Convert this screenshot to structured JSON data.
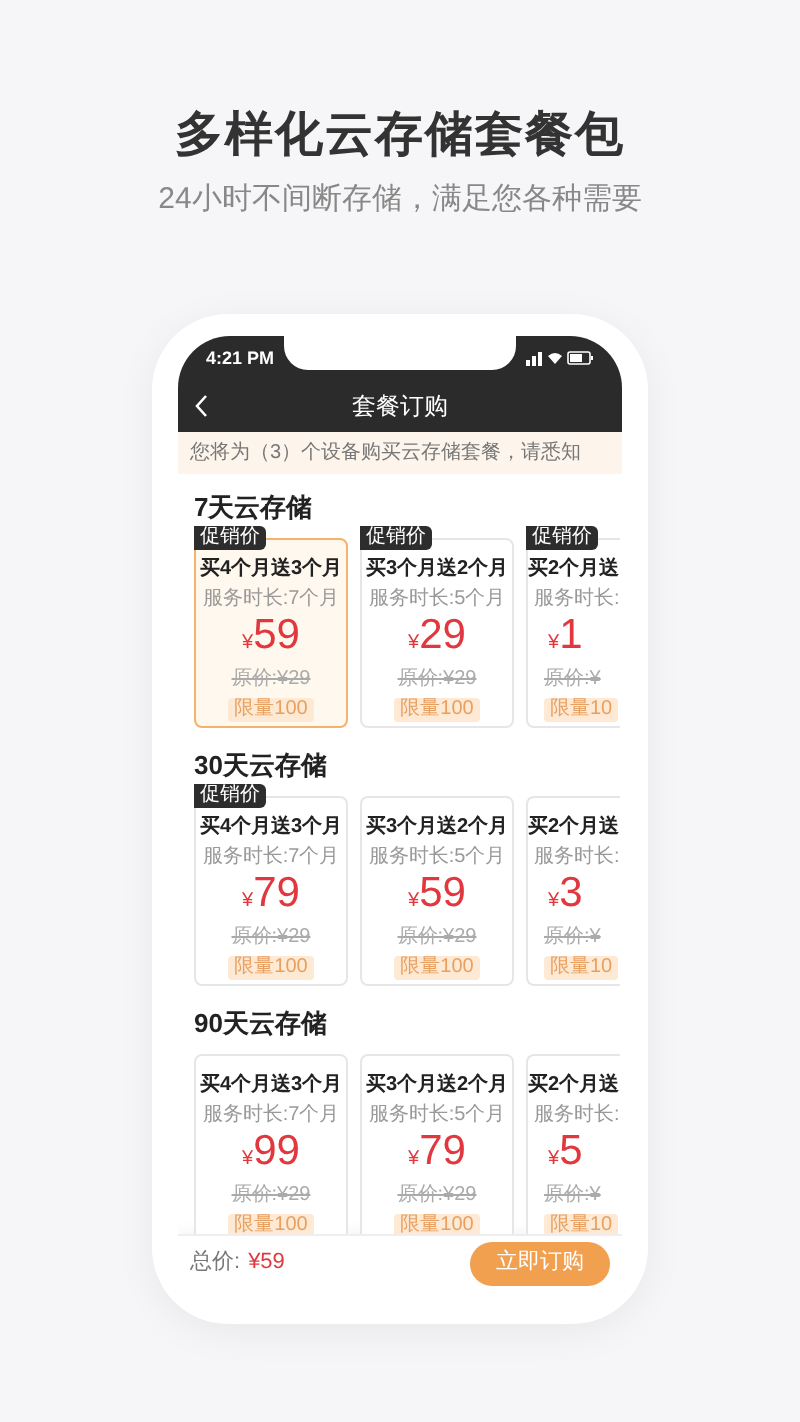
{
  "headline": "多样化云存储套餐包",
  "subheadline": "24小时不间断存储，满足您各种需要",
  "status_bar": {
    "time": "4:21 PM"
  },
  "nav": {
    "title": "套餐订购"
  },
  "notice": "您将为（3）个设备购买云存储套餐，请悉知",
  "sections": [
    {
      "title": "7天云存储",
      "plans": [
        {
          "kind": "full",
          "badge": "促销价",
          "name": "买4个月送3个月",
          "duration": "服务时长:7个月",
          "currency": "¥",
          "price": "59",
          "original": "原价:¥29",
          "limit": "限量100",
          "selected": true
        },
        {
          "kind": "full",
          "badge": "促销价",
          "name": "买3个月送2个月",
          "duration": "服务时长:5个月",
          "currency": "¥",
          "price": "29",
          "original": "原价:¥29",
          "limit": "限量100",
          "selected": false
        },
        {
          "kind": "cut",
          "badge": "促销价",
          "name": "买2个月送",
          "duration": "服务时长:",
          "currency": "¥",
          "price": "1",
          "original": "原价:¥",
          "limit": "限量10",
          "selected": false
        }
      ]
    },
    {
      "title": "30天云存储",
      "plans": [
        {
          "kind": "full",
          "badge": "促销价",
          "name": "买4个月送3个月",
          "duration": "服务时长:7个月",
          "currency": "¥",
          "price": "79",
          "original": "原价:¥29",
          "limit": "限量100",
          "selected": false
        },
        {
          "kind": "full",
          "name": "买3个月送2个月",
          "duration": "服务时长:5个月",
          "currency": "¥",
          "price": "59",
          "original": "原价:¥29",
          "limit": "限量100",
          "selected": false
        },
        {
          "kind": "cut",
          "name": "买2个月送",
          "duration": "服务时长:",
          "currency": "¥",
          "price": "3",
          "original": "原价:¥",
          "limit": "限量10",
          "selected": false
        }
      ]
    },
    {
      "title": "90天云存储",
      "plans": [
        {
          "kind": "full",
          "name": "买4个月送3个月",
          "duration": "服务时长:7个月",
          "currency": "¥",
          "price": "99",
          "original": "原价:¥29",
          "limit": "限量100",
          "selected": false
        },
        {
          "kind": "full",
          "name": "买3个月送2个月",
          "duration": "服务时长:5个月",
          "currency": "¥",
          "price": "79",
          "original": "原价:¥29",
          "limit": "限量100",
          "selected": false
        },
        {
          "kind": "cut",
          "name": "买2个月送",
          "duration": "服务时长:",
          "currency": "¥",
          "price": "5",
          "original": "原价:¥",
          "limit": "限量10",
          "selected": false
        }
      ]
    }
  ],
  "footer": {
    "total_label": "总价:",
    "total": "¥59",
    "button": "立即订购"
  }
}
